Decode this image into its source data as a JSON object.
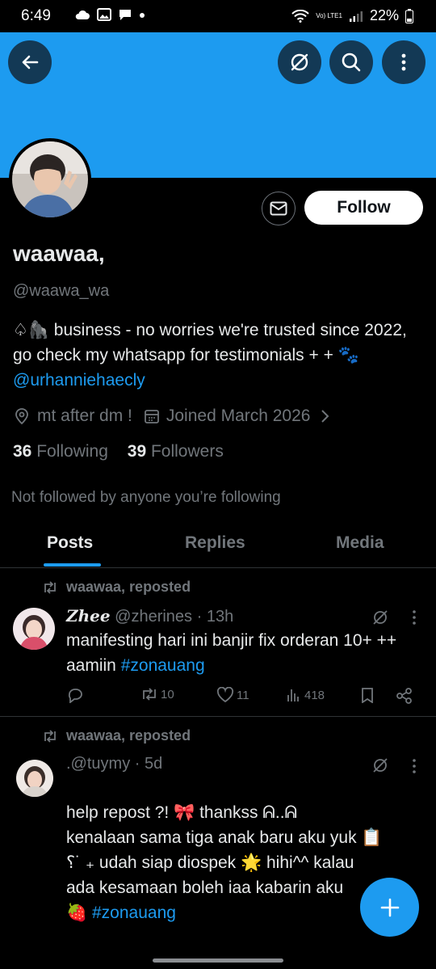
{
  "status_bar": {
    "time": "6:49",
    "network": "Vo) LTE1",
    "battery": "22%"
  },
  "header": {
    "back_icon": "arrow-left-icon",
    "grok_icon": "slash-circle-icon",
    "search_icon": "search-icon",
    "more_icon": "more-vertical-icon",
    "banner_color": "#1d9bf0"
  },
  "profile": {
    "name": "waawaa,",
    "handle": "@waawa_wa",
    "bio_prefix": "♤🦍 business - no worries we're trusted since 2022, go check my whatsapp for testimonials + + 🐾",
    "bio_link": "@urhanniehaecly",
    "location": "mt after dm !",
    "joined": "Joined March 2026",
    "following_count": "36",
    "following_label": "Following",
    "followers_count": "39",
    "followers_label": "Followers",
    "not_followed_note": "Not followed by anyone you’re following",
    "follow_label": "Follow",
    "message_icon": "mail-icon"
  },
  "tabs": [
    {
      "label": "Posts",
      "active": true
    },
    {
      "label": "Replies",
      "active": false
    },
    {
      "label": "Media",
      "active": false
    }
  ],
  "posts": [
    {
      "repost_label": "waawaa, reposted",
      "display_name": "Zhee",
      "handle_time": "@zherines · 13h",
      "text": "manifesting hari ini banjir fix orderan 10+ ++ aamiin",
      "hashtag": "#zonauang",
      "replies": "",
      "reposts": "10",
      "likes": "11",
      "views": "418"
    },
    {
      "repost_label": "waawaa, reposted",
      "display_name": "",
      "handle_time": ".@tuymy · 5d",
      "text_lines": [
        "help repost ?! 🎀 thankss ᕱ..ᕱ",
        "kenalaan sama tiga anak baru aku yuk 📋",
        "⸮˙ ₊ udah siap diospek 🌟 hihi^^ kalau",
        "ada kesamaan boleh iaa kabarin aku"
      ],
      "last_line_prefix": "🍓",
      "hashtag": "#zonauang"
    }
  ],
  "fab_icon": "plus-icon",
  "accent_color": "#1d9bf0"
}
